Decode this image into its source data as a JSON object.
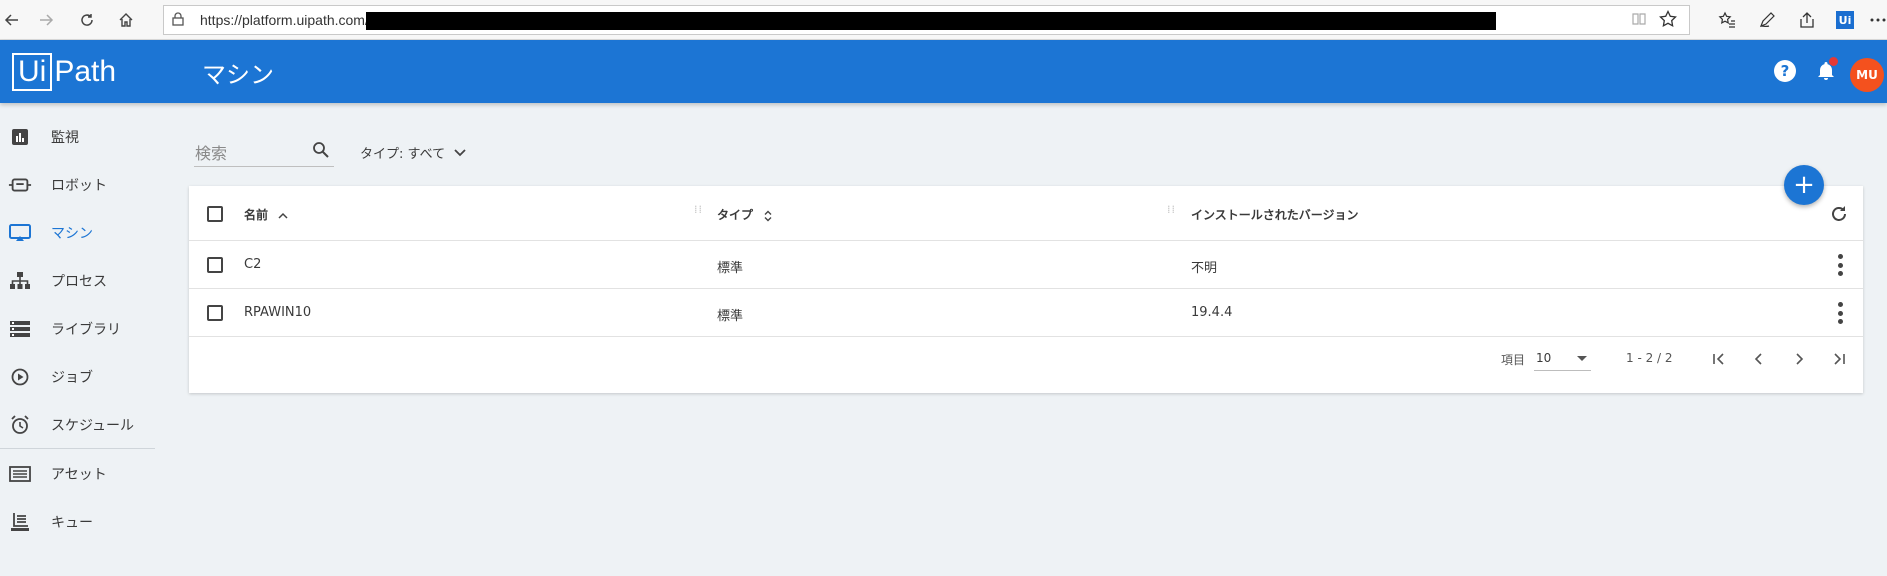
{
  "browser": {
    "url_visible": "https://platform.uipath.com/",
    "extension_label": "Ui"
  },
  "app": {
    "logo_ui": "Ui",
    "logo_path": "Path",
    "page_title": "マシン",
    "help_glyph": "?",
    "avatar_initials": "MU"
  },
  "sidebar": {
    "items": [
      {
        "label": "監視",
        "icon": "monitoring-icon"
      },
      {
        "label": "ロボット",
        "icon": "robot-icon"
      },
      {
        "label": "マシン",
        "icon": "machine-icon",
        "active": true
      },
      {
        "label": "プロセス",
        "icon": "process-icon"
      },
      {
        "label": "ライブラリ",
        "icon": "library-icon"
      },
      {
        "label": "ジョブ",
        "icon": "job-icon"
      },
      {
        "label": "スケジュール",
        "icon": "schedule-icon"
      },
      {
        "label": "アセット",
        "icon": "asset-icon"
      },
      {
        "label": "キュー",
        "icon": "queue-icon"
      }
    ]
  },
  "filters": {
    "search_placeholder": "検索",
    "type_filter_label": "タイプ: すべて"
  },
  "table": {
    "columns": [
      {
        "label": "名前",
        "sort": "asc"
      },
      {
        "label": "タイプ",
        "sort": "both"
      },
      {
        "label": "インストールされたバージョン",
        "sort": "none"
      }
    ],
    "rows": [
      {
        "name": "C2",
        "type": "標準",
        "version": "不明"
      },
      {
        "name": "RPAWIN10",
        "type": "標準",
        "version": "19.4.4"
      }
    ],
    "footer": {
      "per_page_label": "項目",
      "per_page_value": "10",
      "range_text": "1 - 2 / 2"
    }
  },
  "fab_glyph": "+",
  "colors": {
    "primary": "#1c75d4",
    "avatar": "#f4511e",
    "notification_dot": "#e53935"
  }
}
